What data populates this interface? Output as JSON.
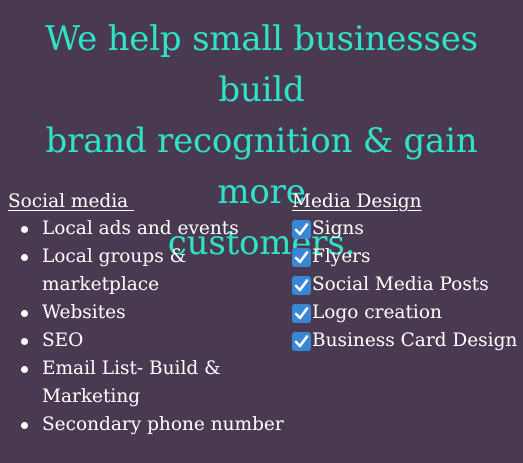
{
  "headline": [
    "We help small businesses build",
    "brand recognition & gain more",
    "customers."
  ],
  "social_media": {
    "heading": "Social media ",
    "items": [
      "Local ads and events",
      "Local groups &",
      "marketplace",
      "Websites",
      "SEO",
      "Email List- Build &",
      "Marketing",
      "Secondary phone number"
    ]
  },
  "media_design": {
    "heading": "Media Design",
    "items": [
      "Signs",
      "Flyers",
      "Social Media Posts",
      "Logo creation",
      "Business Card Design"
    ]
  },
  "colors": {
    "background": "#4a3a51",
    "headline": "#2fe3c9",
    "text": "#ffffff",
    "checkbox": "#3a86d6"
  }
}
